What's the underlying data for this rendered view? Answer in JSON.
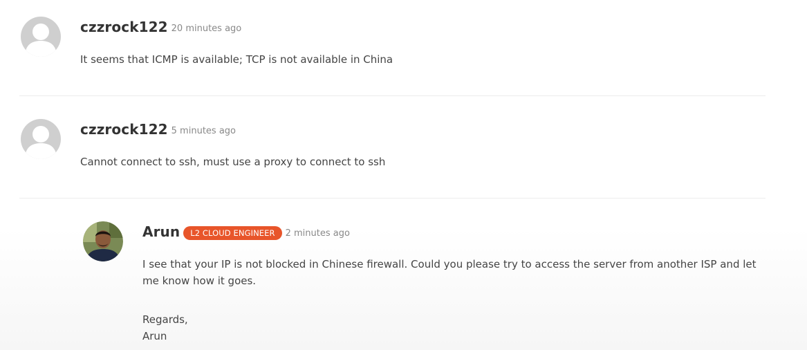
{
  "comments": [
    {
      "author": "czzrock122",
      "time": "20 minutes ago",
      "text": "It seems that ICMP is available; TCP is not available in China"
    },
    {
      "author": "czzrock122",
      "time": "5 minutes ago",
      "text": "Cannot connect to ssh, must use a proxy to connect to ssh"
    },
    {
      "author": "Arun",
      "badge": "L2 CLOUD ENGINEER",
      "time": "2 minutes ago",
      "text_lines": [
        "I see that your IP is not blocked in Chinese firewall. Could you please try to access the server from another ISP and let",
        "me know how it goes."
      ],
      "signoff": "Regards,",
      "signature": "Arun"
    }
  ],
  "colors": {
    "badge": "#e8552a",
    "avatar_placeholder": "#c8c8c8",
    "divider": "#ececec"
  }
}
